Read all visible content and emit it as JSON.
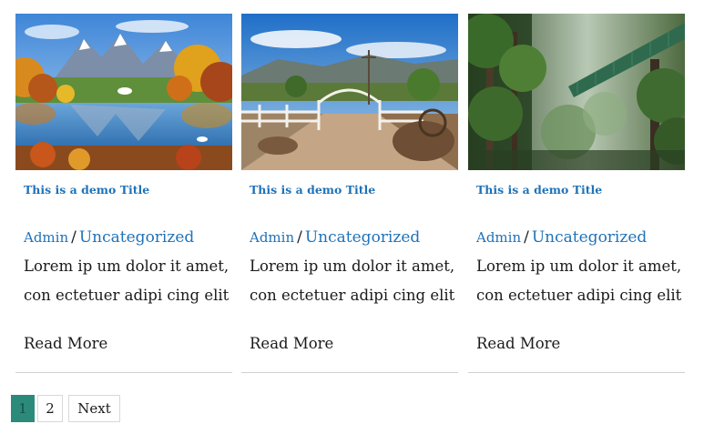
{
  "posts": [
    {
      "image": "autumn-lake-mountains",
      "title": "This is a demo Title",
      "author": "Admin",
      "separator": "/",
      "category": "Uncategorized",
      "excerpt_line1": "Lorem ip um dolor it amet,",
      "excerpt_line2": "con ectetuer adipi cing elit",
      "read_more": "Read More"
    },
    {
      "image": "ranch-gate-dirt-road",
      "title": "This is a demo Title",
      "author": "Admin",
      "separator": "/",
      "category": "Uncategorized",
      "excerpt_line1": "Lorem ip um dolor it amet,",
      "excerpt_line2": "con ectetuer adipi cing elit",
      "read_more": "Read More"
    },
    {
      "image": "rainforest-canopy-bridge",
      "title": "This is a demo Title",
      "author": "Admin",
      "separator": "/",
      "category": "Uncategorized",
      "excerpt_line1": "Lorem ip um dolor it amet,",
      "excerpt_line2": "con ectetuer adipi cing elit",
      "read_more": "Read More"
    }
  ],
  "pagination": {
    "current": "1",
    "page2": "2",
    "next": "Next",
    "active_color": "#2b8a7a"
  },
  "colors": {
    "link": "#1f72b8",
    "text": "#1a1a1a"
  }
}
